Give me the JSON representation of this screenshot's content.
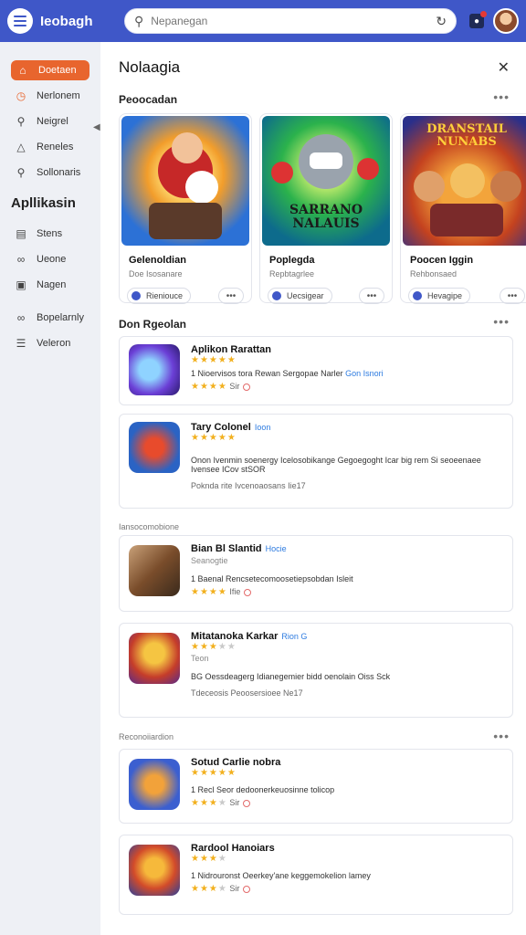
{
  "header": {
    "brand": "Ieobagh",
    "search_placeholder": "Nepanegan"
  },
  "sidebar": {
    "items": [
      {
        "label": "Doetaen",
        "icon": "home-icon",
        "active": true
      },
      {
        "label": "Nerlonem",
        "icon": "clock-icon"
      },
      {
        "label": "Neigrel",
        "icon": "search-icon"
      },
      {
        "label": "Reneles",
        "icon": "bell-icon"
      },
      {
        "label": "Sollonaris",
        "icon": "search-icon"
      }
    ],
    "section_title": "Apllikasin",
    "section_items": [
      {
        "label": "Stens",
        "icon": "chart-icon"
      },
      {
        "label": "Ueone",
        "icon": "link-icon"
      },
      {
        "label": "Nagen",
        "icon": "image-icon"
      },
      {
        "label": "Bopelarnly",
        "icon": "link-icon"
      },
      {
        "label": "Veleron",
        "icon": "list-icon"
      }
    ]
  },
  "panel": {
    "title": "Nolaagia",
    "featured_heading": "Peoocadan",
    "featured": [
      {
        "name": "Gelenoldian",
        "sub": "Doe Isosanare",
        "chip": "Rieniouce",
        "art_title": ""
      },
      {
        "name": "Poplegda",
        "sub": "Repbtagrlee",
        "chip": "Uecsigear",
        "art_title": "SARRANO NALAUIS"
      },
      {
        "name": "Poocen Iggin",
        "sub": "Rehbonsaed",
        "chip": "Hevagipe",
        "art_title": "DRANSTAIL NUNABS"
      }
    ],
    "list_heading": "Don Rgeolan",
    "list": [
      {
        "title": "Aplikon Rarattan",
        "tag": "",
        "stars": 5,
        "meta": "",
        "desc": "1  Nioervisos tora Rewan Sergopae Narler",
        "desc_link": "Gon Isnori",
        "foot_stars": 4,
        "foot_text": "Sir"
      },
      {
        "title": "Tary Colonel",
        "tag": "Ioon",
        "stars": 5,
        "meta": "",
        "desc": "Onon Ivenmin soenergy Icelosobikange Gegoegoght Icar big rem Si seoeenaee Ivensee ICov stSOR",
        "desc_link": "",
        "foot_stars": 0,
        "foot_text": "Poknda rite Ivcenoaosans Iie17"
      }
    ],
    "small_heading_1": "Iansocomobione",
    "list2": [
      {
        "title": "Bian Bl Slantid",
        "tag": "Hocie",
        "stars": 0,
        "meta": "Seanogtie",
        "desc": "1  Baenal Rencsetecomoosetiepsobdan Isleit",
        "desc_link": "",
        "foot_stars": 4,
        "foot_text": "Ifie"
      },
      {
        "title": "Mitatanoka Karkar",
        "tag": "Rion G",
        "stars": 3,
        "meta": "Teon",
        "desc": "BG  Oessdeagerg Idianegemier bidd oenolain Oiss Sck",
        "desc_link": "",
        "foot_stars": 0,
        "foot_text": "Tdeceosis  Peoosersioee Ne17"
      }
    ],
    "small_heading_2": "Reconoiiardion",
    "list3": [
      {
        "title": "Sotud Carlie nobra",
        "tag": "",
        "stars": 5,
        "meta": "",
        "desc": "1  Recl Seor dedoonerkeuosinne tolicop",
        "desc_link": "",
        "foot_stars": 3,
        "foot_text": "Sir"
      },
      {
        "title": "Rardool Hanoiars",
        "tag": "",
        "stars": 3,
        "meta": "",
        "desc": "1  Nidrouronst Oeerkey'ane keggemokelion lamey",
        "desc_link": "",
        "foot_stars": 3,
        "foot_text": "Sir"
      }
    ]
  }
}
